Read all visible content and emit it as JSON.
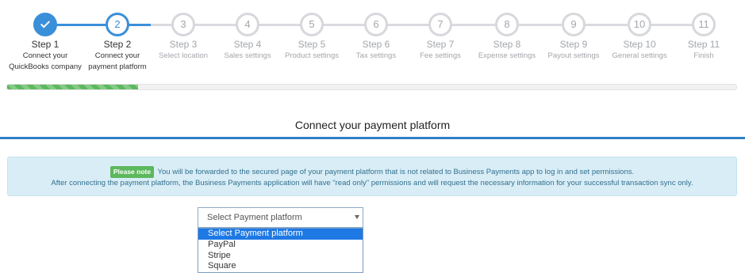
{
  "steps": [
    {
      "title": "Step 1",
      "sub1": "Connect your",
      "sub2": "QuickBooks company",
      "num": "1",
      "state": "complete"
    },
    {
      "title": "Step 2",
      "sub1": "Connect your",
      "sub2": "payment platform",
      "num": "2",
      "state": "active"
    },
    {
      "title": "Step 3",
      "sub1": "Select location",
      "sub2": "",
      "num": "3",
      "state": "pending"
    },
    {
      "title": "Step 4",
      "sub1": "Sales settings",
      "sub2": "",
      "num": "4",
      "state": "pending"
    },
    {
      "title": "Step 5",
      "sub1": "Product settings",
      "sub2": "",
      "num": "5",
      "state": "pending"
    },
    {
      "title": "Step 6",
      "sub1": "Tax settings",
      "sub2": "",
      "num": "6",
      "state": "pending"
    },
    {
      "title": "Step 7",
      "sub1": "Fee settings",
      "sub2": "",
      "num": "7",
      "state": "pending"
    },
    {
      "title": "Step 8",
      "sub1": "Expense settings",
      "sub2": "",
      "num": "8",
      "state": "pending"
    },
    {
      "title": "Step 9",
      "sub1": "Payout settings",
      "sub2": "",
      "num": "9",
      "state": "pending"
    },
    {
      "title": "Step 10",
      "sub1": "General settings",
      "sub2": "",
      "num": "10",
      "state": "pending"
    },
    {
      "title": "Step 11",
      "sub1": "Finish",
      "sub2": "",
      "num": "11",
      "state": "pending"
    }
  ],
  "progress": {
    "fraction": 0.18,
    "color": "#5cb85c"
  },
  "page": {
    "title": "Connect your payment platform"
  },
  "alert": {
    "badge": "Please note",
    "line1": "You will be forwarded to the secured page of your payment platform that is not related to Business Payments app to log in and set permissions.",
    "line2": "After connecting the payment platform, the Business Payments application will have \"read only\" permissions and will request the necessary information for your successful transaction sync only."
  },
  "select": {
    "value": "Select Payment platform",
    "options": [
      "Select Payment platform",
      "PayPal",
      "Stripe",
      "Square"
    ],
    "selected_index": 0
  },
  "colors": {
    "accent": "#3a8fd9",
    "alert_bg": "#d9edf6",
    "alert_text": "#31708f",
    "badge": "#5cb85c"
  }
}
